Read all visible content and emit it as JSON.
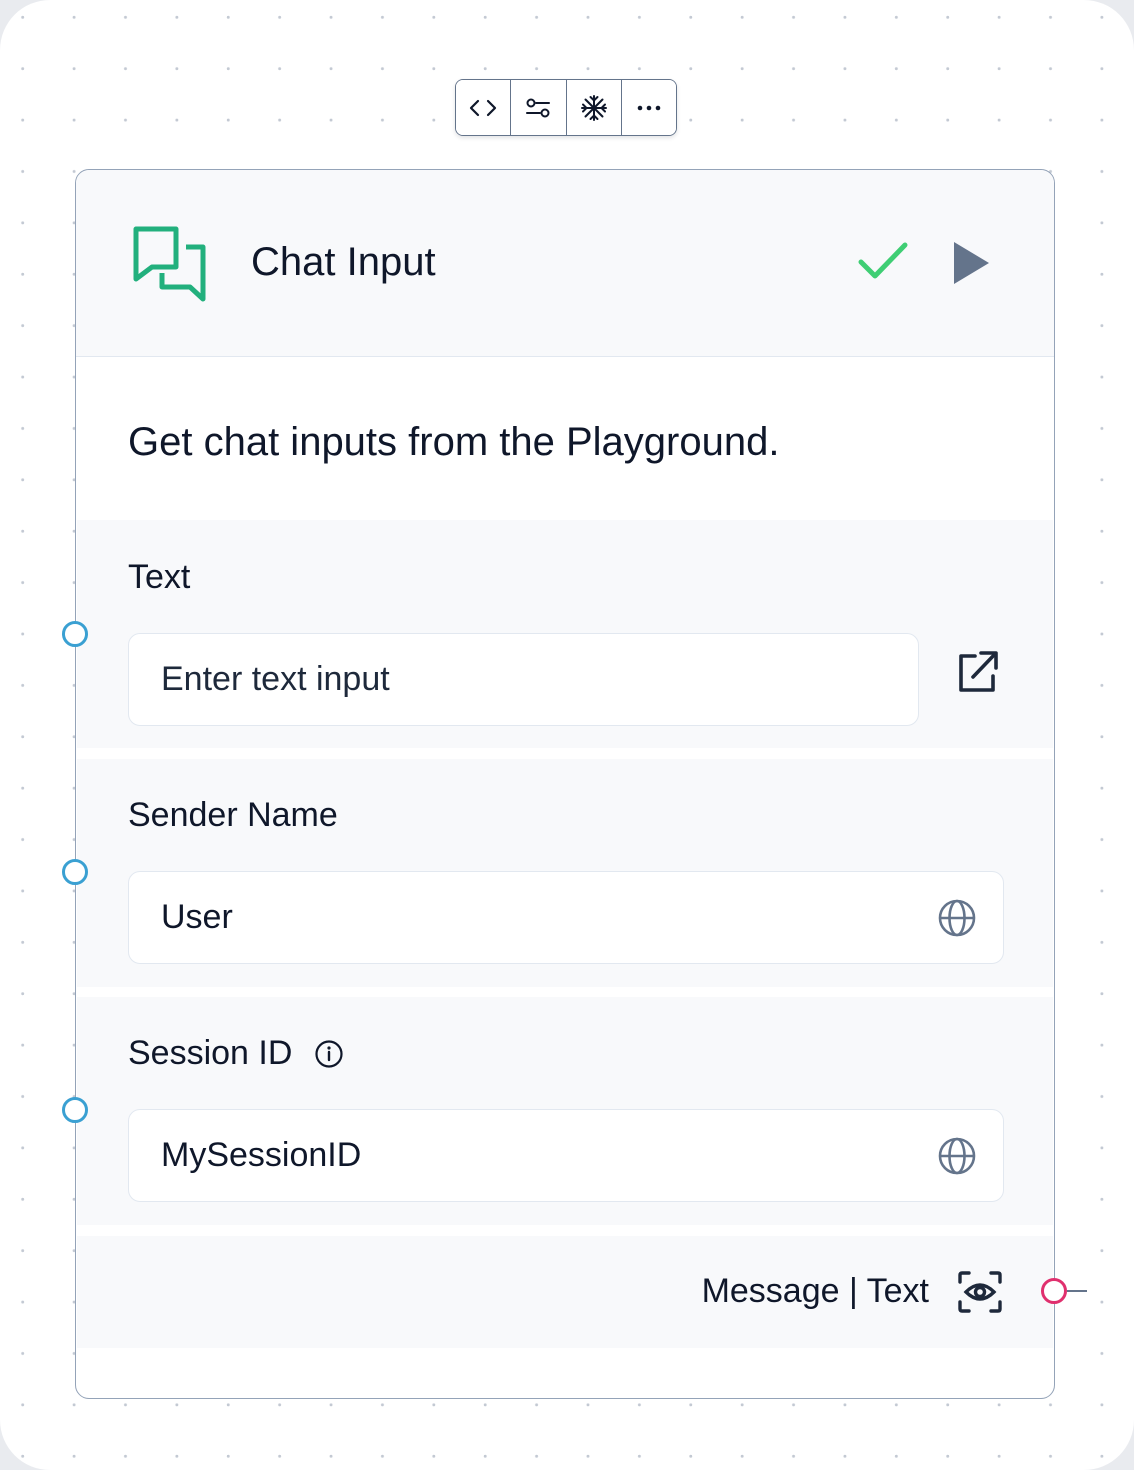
{
  "toolbar": {
    "buttons": [
      {
        "name": "code-button",
        "icon": "code-icon"
      },
      {
        "name": "controls-button",
        "icon": "sliders-icon"
      },
      {
        "name": "freeze-button",
        "icon": "snowflake-icon"
      },
      {
        "name": "more-button",
        "icon": "ellipsis-icon"
      }
    ]
  },
  "node": {
    "title": "Chat Input",
    "icon": "chat-bubbles-icon",
    "status": "check-icon",
    "description": "Get chat inputs from the Playground.",
    "fields": {
      "text": {
        "label": "Text",
        "placeholder": "Enter text input",
        "action_icon": "external-link-icon"
      },
      "sender_name": {
        "label": "Sender Name",
        "value": "User",
        "action_icon": "globe-icon"
      },
      "session_id": {
        "label": "Session ID",
        "value": "MySessionID",
        "info_icon": "info-icon",
        "action_icon": "globe-icon"
      }
    },
    "output": {
      "label": "Message | Text",
      "icon": "eye-icon"
    }
  },
  "colors": {
    "accent_green": "#22c55e",
    "input_handle": "#3aa0d2",
    "output_handle": "#e0306e",
    "icon_slate": "#64748b"
  }
}
